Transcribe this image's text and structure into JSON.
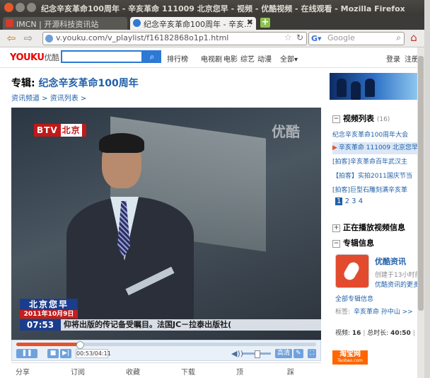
{
  "window": {
    "title": "纪念辛亥革命100周年 - 辛亥革命 111009 北京您早 - 视频 - 优酷视频 - 在线观看 - Mozilla Firefox"
  },
  "tabs": [
    {
      "label": "IMCN | 开源科技资讯站"
    },
    {
      "label": "纪念辛亥革命100周年 - 辛亥...",
      "close": "✖"
    }
  ],
  "navbar": {
    "url": "v.youku.com/v_playlist/f16182868o1p1.html",
    "search_placeholder": "Google"
  },
  "site": {
    "logo": "YOUKU",
    "logo_cn": "优酷",
    "nav": [
      "排行榜",
      "电视剧",
      "电影",
      "综艺",
      "动漫",
      "全部▾"
    ],
    "login": "登录",
    "register": "注册"
  },
  "page": {
    "title_prefix": "专辑:",
    "title": "纪念辛亥革命100周年",
    "breadcrumb": "资讯频道 > 资讯列表 >"
  },
  "player": {
    "channel_logo": "BTV",
    "channel_city": "北京",
    "watermark": "优酷",
    "program_name": "北京您早",
    "date": "2011年10月9日",
    "clock": "07:53",
    "ticker": "仰将出版的传记备受瞩目。法国JC－拉泰出版社(",
    "time_display": "00:53/04:11",
    "progress": 0.21,
    "volume": 0.5,
    "quality_label": "高清"
  },
  "actions": [
    "分享",
    "订阅",
    "收藏",
    "下载",
    "顶",
    "踩"
  ],
  "sidebar": {
    "playlist_title": "视频列表",
    "playlist_count": "(16)",
    "playlist_items": [
      "纪念辛亥革命100周年大会",
      "辛亥革命 111009 北京您早",
      "[拍客]辛亥革命百年武汉主",
      "【拍客】实拍2011国庆节当",
      "[拍客]巨型石雕刻满辛亥革"
    ],
    "pages": [
      "1",
      "2",
      "3",
      "4"
    ],
    "now_playing_title": "正在播放视频信息",
    "album_info_title": "专辑信息",
    "channel_name": "优酷资讯",
    "created": "创建于13小时前",
    "more_link": "优酷资讯的更多",
    "all_albums": "全部专辑信息",
    "tags_label": "标签:",
    "tags": "辛亥革命 孙中山 >>",
    "videos_label": "视频:",
    "videos_value": "16",
    "duration_label": "总时长:",
    "duration_value": "40:50",
    "plays_label": "总播",
    "taobao": "淘宝网",
    "taobao_sub": "Taobao.com"
  }
}
